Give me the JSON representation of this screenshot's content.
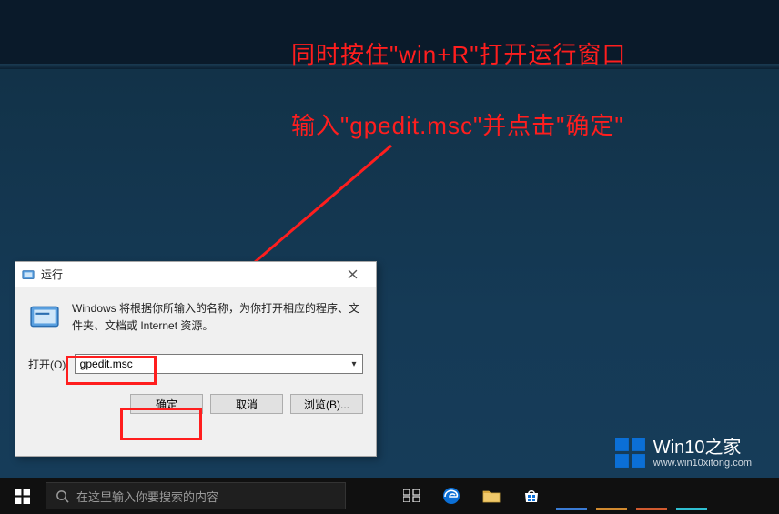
{
  "annotation": {
    "line1": "同时按住\"win+R\"打开运行窗口",
    "line2": "输入\"gpedit.msc\"并点击\"确定\""
  },
  "colors": {
    "annotation_red": "#ff1e1e",
    "accent_blue": "#0b6fd6"
  },
  "run_dialog": {
    "title": "运行",
    "description": "Windows 将根据你所输入的名称，为你打开相应的程序、文件夹、文档或 Internet 资源。",
    "open_label": "打开(O):",
    "input_value": "gpedit.msc",
    "buttons": {
      "ok": "确定",
      "cancel": "取消",
      "browse": "浏览(B)..."
    }
  },
  "taskbar": {
    "search_placeholder": "在这里输入你要搜索的内容",
    "icons": {
      "start": "windows-start-icon",
      "search": "search-icon",
      "task_view": "task-view-icon",
      "edge": "edge-icon",
      "explorer": "file-explorer-icon",
      "store": "store-icon"
    },
    "running_apps": [
      {
        "accent": "#3a7bd5"
      },
      {
        "accent": "#d18a2f"
      },
      {
        "accent": "#d15a2f"
      },
      {
        "accent": "#2fbfd1"
      }
    ]
  },
  "watermark": {
    "title": "Win10之家",
    "url": "www.win10xitong.com"
  }
}
